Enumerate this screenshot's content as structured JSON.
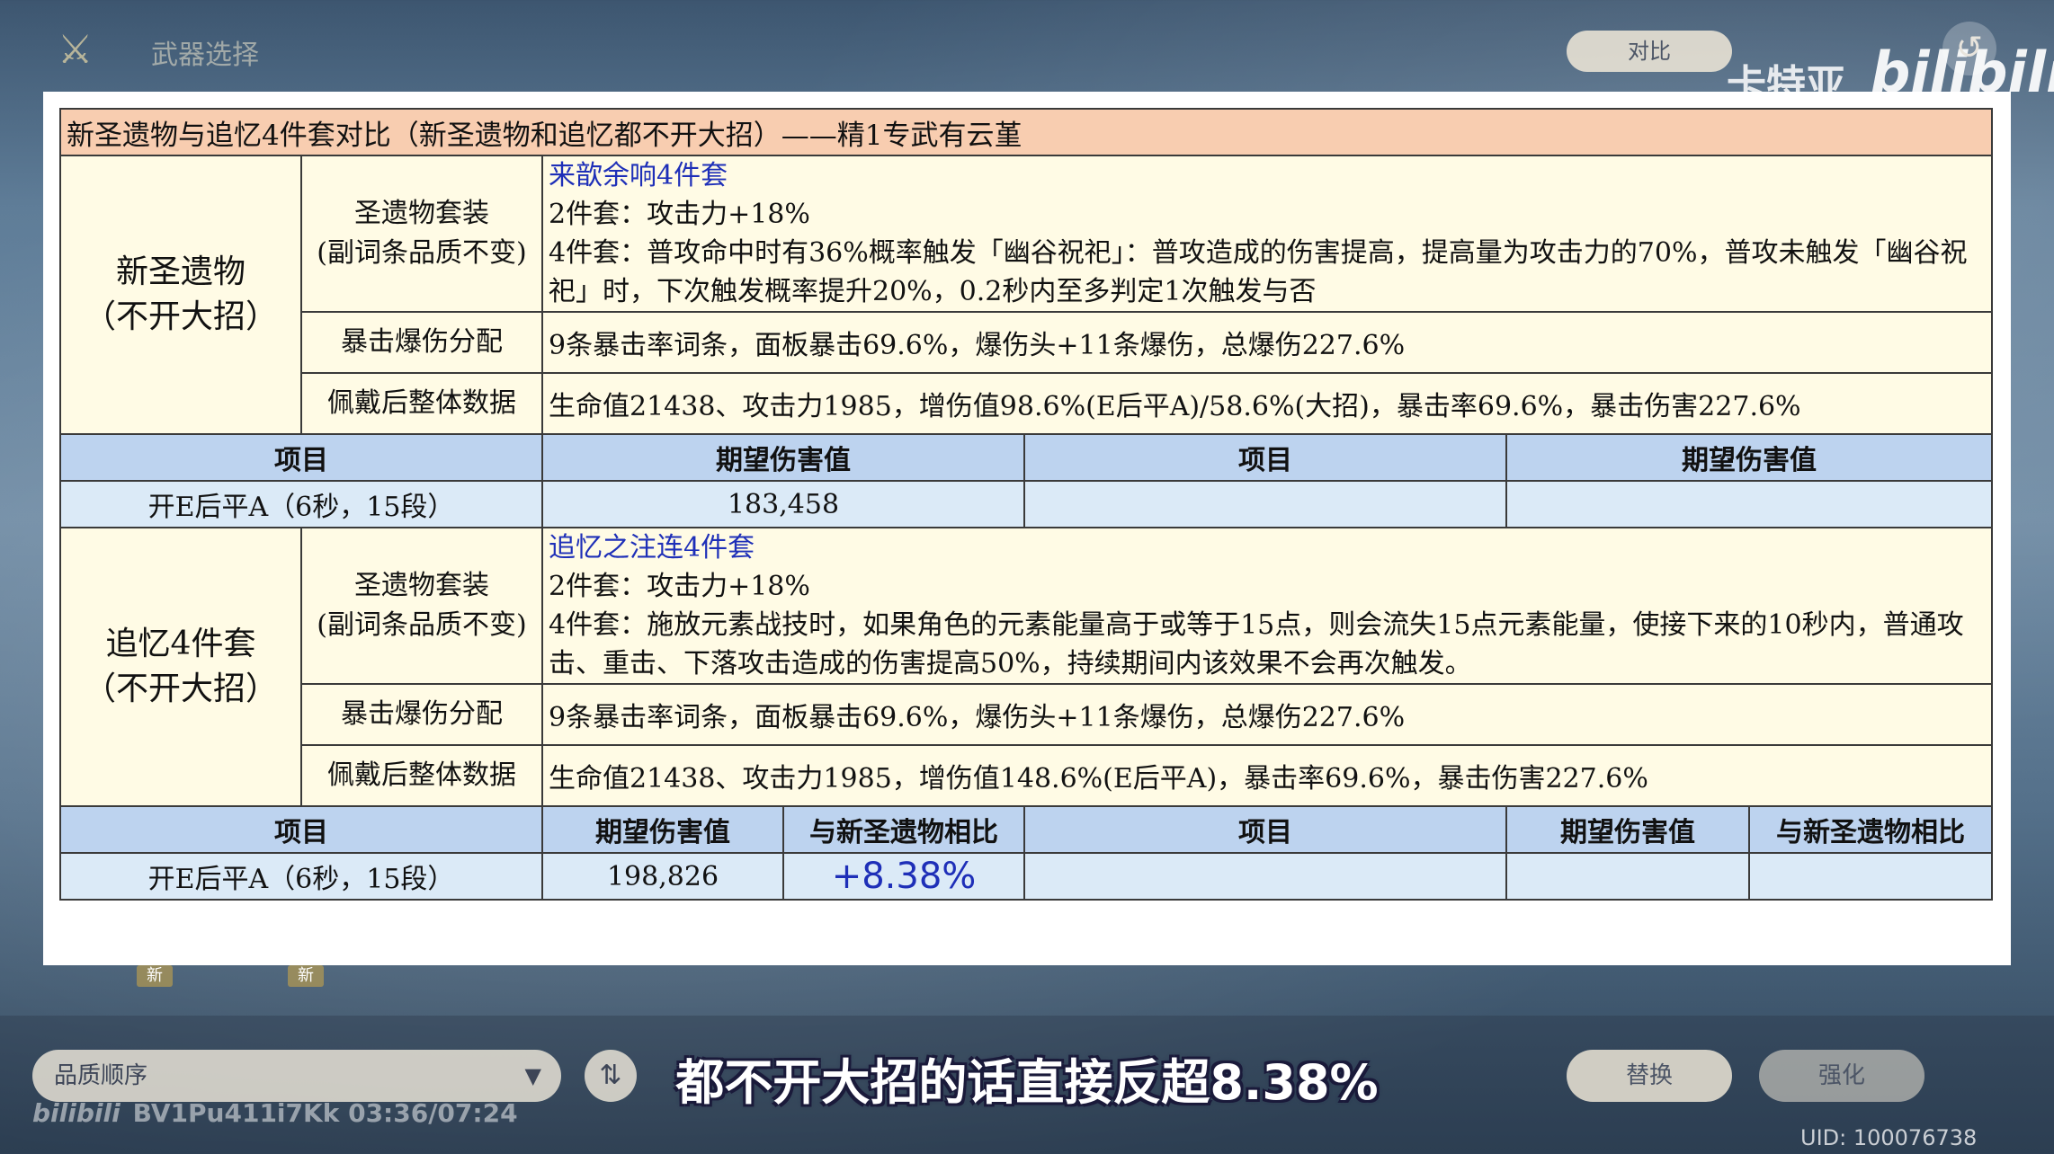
{
  "top_bar": {
    "title": "武器选择",
    "compare_button": "对比",
    "channel_name": "卡特亚",
    "bilibili_logo": "bilibili",
    "back_icon": "back-icon",
    "weapon_icon": "sword-icon"
  },
  "table": {
    "title": "新圣遗物与追忆4件套对比（新圣遗物和追忆都不开大招）——精1专武有云堇",
    "sections": [
      {
        "label_line1": "新圣遗物",
        "label_line2": "（不开大招）",
        "set_label_line1": "圣遗物套装",
        "set_label_line2": "(副词条品质不变)",
        "set_name": "来歆余响4件套",
        "set_desc_1": "2件套：攻击力+18%",
        "set_desc_2": "4件套：普攻命中时有36%概率触发「幽谷祝祀」：普攻造成的伤害提高，提高量为攻击力的70%，普攻未触发「幽谷祝祀」时，下次触发概率提升20%，0.2秒内至多判定1次触发与否",
        "crit_label": "暴击爆伤分配",
        "crit_value": "9条暴击率词条，面板暴击69.6%，爆伤头+11条爆伤，总爆伤227.6%",
        "stats_label": "佩戴后整体数据",
        "stats_value": "生命值21438、攻击力1985，增伤值98.6%(E后平A)/58.6%(大招)，暴击率69.6%，暴击伤害227.6%",
        "result_header": [
          "项目",
          "期望伤害值",
          "项目",
          "期望伤害值"
        ],
        "result_row": [
          "开E后平A（6秒，15段）",
          "183,458",
          "",
          ""
        ]
      },
      {
        "label_line1": "追忆4件套",
        "label_line2": "（不开大招）",
        "set_label_line1": "圣遗物套装",
        "set_label_line2": "(副词条品质不变)",
        "set_name": "追忆之注连4件套",
        "set_desc_1": "2件套：攻击力+18%",
        "set_desc_2": "4件套：施放元素战技时，如果角色的元素能量高于或等于15点，则会流失15点元素能量，使接下来的10秒内，普通攻击、重击、下落攻击造成的伤害提高50%，持续期间内该效果不会再次触发。",
        "crit_label": "暴击爆伤分配",
        "crit_value": "9条暴击率词条，面板暴击69.6%，爆伤头+11条爆伤，总爆伤227.6%",
        "stats_label": "佩戴后整体数据",
        "stats_value": "生命值21438、攻击力1985，增伤值148.6%(E后平A)，暴击率69.6%，暴击伤害227.6%",
        "result_header": [
          "项目",
          "期望伤害值",
          "与新圣遗物相比",
          "项目",
          "期望伤害值",
          "与新圣遗物相比"
        ],
        "result_row": [
          "开E后平A（6秒，15段）",
          "198,826",
          "+8.38%",
          "",
          "",
          ""
        ]
      }
    ]
  },
  "inventory_strip": {
    "tags": [
      "新",
      "新"
    ]
  },
  "bottom": {
    "sort_label": "品质顺序",
    "sort_order_icon": "sort-order-icon",
    "replace_button": "替换",
    "enhance_button": "强化",
    "subtitle": "都不开大招的话直接反超8.38%",
    "video_id_time": "BV1Pu411i7Kk 03:36/07:24",
    "video_bili_mark": "bilibili",
    "uid": "UID: 100076738"
  }
}
